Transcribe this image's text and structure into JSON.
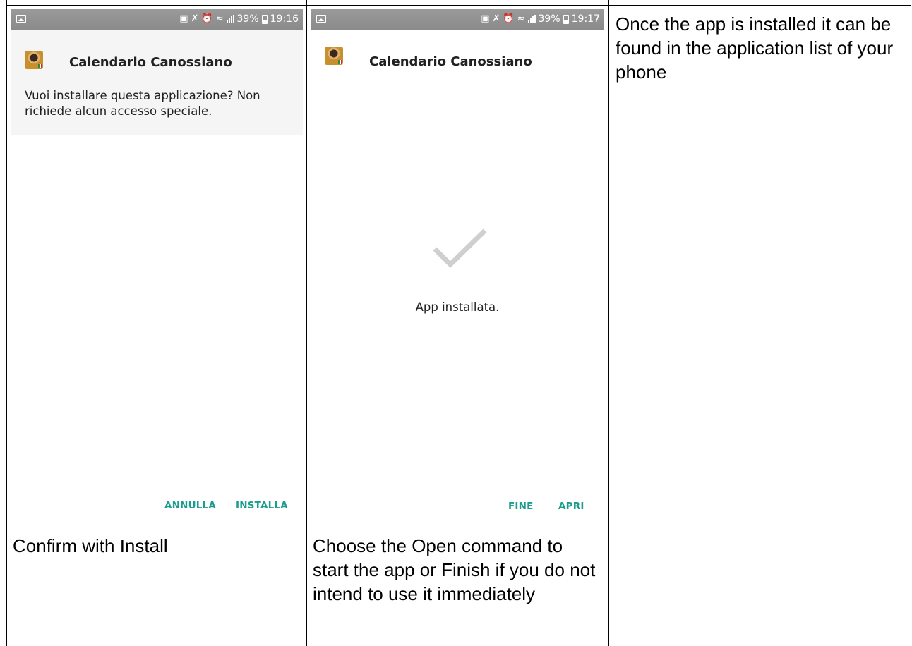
{
  "left_phone": {
    "status_time": "19:16",
    "battery_percent": "39%",
    "app_title": "Calendario Canossiano",
    "question": "Vuoi installare questa applicazione? Non richiede alcun accesso speciale.",
    "cancel_label": "ANNULLA",
    "install_label": "INSTALLA"
  },
  "middle_phone": {
    "status_time": "19:17",
    "battery_percent": "39%",
    "app_title": "Calendario Canossiano",
    "installed_message": "App installata.",
    "finish_label": "FINE",
    "open_label": "APRI"
  },
  "captions": {
    "left": "Confirm with Install",
    "middle": "Choose the Open command to start the app or Finish if you do not intend to use it immediately",
    "right": "Once the app is installed it can be found in the application list of your phone"
  },
  "colors": {
    "accent": "#1a9c8e",
    "status_bar": "#8f8f8f",
    "header_bg": "#f5f5f5"
  },
  "icons": {
    "status_left": "gallery-icon",
    "status_right": [
      "battery-saver-icon",
      "mute-icon",
      "alarm-icon",
      "wifi-icon",
      "signal-icon",
      "battery-icon"
    ],
    "app": "app-logo-icon",
    "installed": "checkmark-icon"
  }
}
